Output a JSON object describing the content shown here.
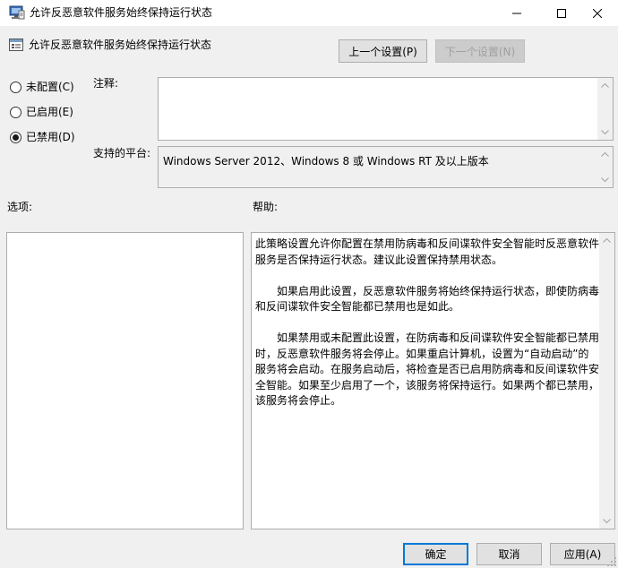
{
  "window": {
    "title": "允许反恶意软件服务始终保持运行状态"
  },
  "header": {
    "policy_title": "允许反恶意软件服务始终保持运行状态",
    "prev_button": "上一个设置(P)",
    "next_button": "下一个设置(N)"
  },
  "state": {
    "options": [
      {
        "label": "未配置(C)",
        "checked": false
      },
      {
        "label": "已启用(E)",
        "checked": false
      },
      {
        "label": "已禁用(D)",
        "checked": true
      }
    ]
  },
  "comment": {
    "label": "注释:",
    "value": ""
  },
  "platform": {
    "label": "支持的平台:",
    "value": "Windows Server 2012、Windows 8 或 Windows RT 及以上版本"
  },
  "options_section": {
    "label": "选项:"
  },
  "help_section": {
    "label": "帮助:",
    "paragraphs": [
      "此策略设置允许你配置在禁用防病毒和反间谍软件安全智能时反恶意软件服务是否保持运行状态。建议此设置保持禁用状态。",
      "如果启用此设置，反恶意软件服务将始终保持运行状态，即使防病毒和反间谍软件安全智能都已禁用也是如此。",
      "如果禁用或未配置此设置，在防病毒和反间谍软件安全智能都已禁用时，反恶意软件服务将会停止。如果重启计算机，设置为“自动启动”的服务将会启动。在服务启动后，将检查是否已启用防病毒和反间谍软件安全智能。如果至少启用了一个，该服务将保持运行。如果两个都已禁用，该服务将会停止。"
    ]
  },
  "footer": {
    "ok_button": "确定",
    "cancel_button": "取消",
    "apply_button": "应用(A)"
  }
}
